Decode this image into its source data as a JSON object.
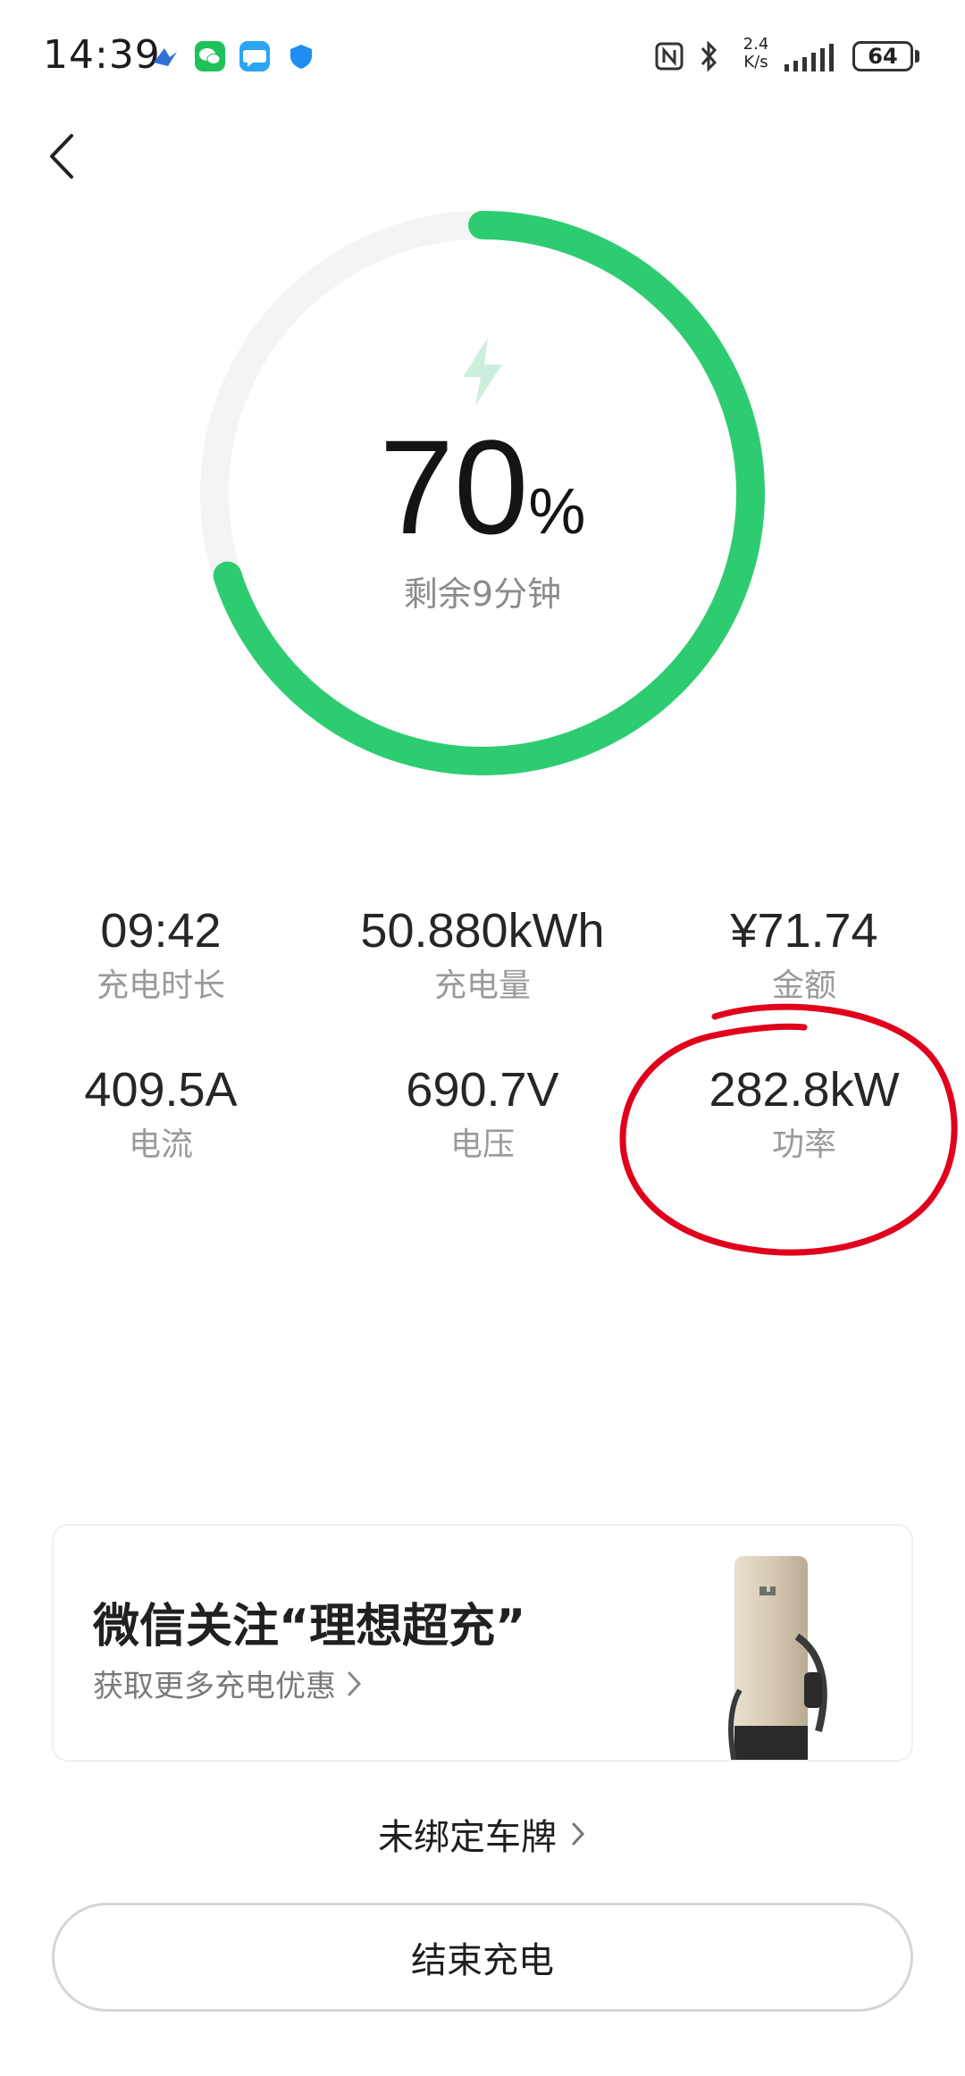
{
  "status_bar": {
    "time": "14:39",
    "app_icons": [
      "arrow-app-icon",
      "wechat-icon",
      "message-icon",
      "shield-icon"
    ],
    "network_speed_value": "2.4",
    "network_speed_unit": "K/s",
    "battery_level": "64"
  },
  "charging": {
    "percent": "70",
    "percent_sign": "%",
    "progress_fraction": 0.7,
    "remaining_text": "剩余9分钟",
    "accent_color": "#2ecc71"
  },
  "stats": [
    {
      "value": "09:42",
      "label": "充电时长"
    },
    {
      "value": "50.880kWh",
      "label": "充电量"
    },
    {
      "value": "¥71.74",
      "label": "金额"
    },
    {
      "value": "409.5A",
      "label": "电流"
    },
    {
      "value": "690.7V",
      "label": "电压"
    },
    {
      "value": "282.8kW",
      "label": "功率"
    }
  ],
  "annotation_color": "#e0001b",
  "promo": {
    "title": "微信关注“理想超充”",
    "subtitle": "获取更多充电优惠"
  },
  "plate_link": "未绑定车牌",
  "end_button": "结束充电"
}
